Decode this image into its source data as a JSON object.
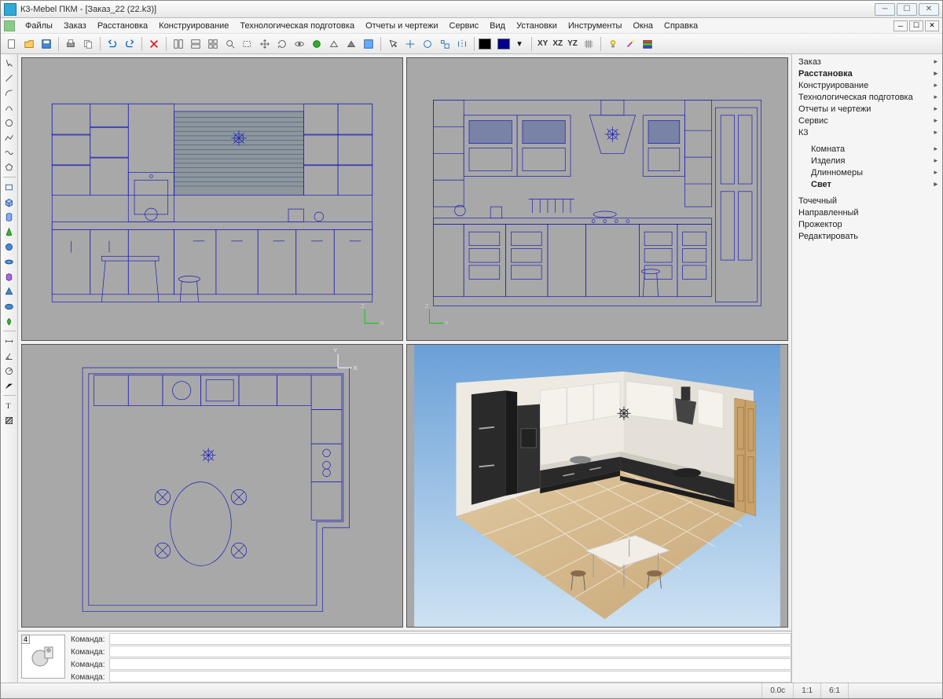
{
  "window": {
    "title": "К3-Mebel ПКМ - [Заказ_22 (22.k3)]"
  },
  "menu": [
    "Файлы",
    "Заказ",
    "Расстановка",
    "Конструирование",
    "Технологическая подготовка",
    "Отчеты и чертежи",
    "Сервис",
    "Вид",
    "Установки",
    "Инструменты",
    "Окна",
    "Справка"
  ],
  "axes_labels": {
    "xy": "XY",
    "xz": "XZ",
    "yz": "YZ"
  },
  "rightpanel": {
    "group1": [
      {
        "label": "Заказ",
        "bold": false
      },
      {
        "label": "Расстановка",
        "bold": true
      },
      {
        "label": "Конструирование",
        "bold": false
      },
      {
        "label": "Технологическая подготовка",
        "bold": false
      },
      {
        "label": "Отчеты и чертежи",
        "bold": false
      },
      {
        "label": "Сервис",
        "bold": false
      },
      {
        "label": "К3",
        "bold": false
      }
    ],
    "group2": [
      {
        "label": "Комната",
        "bold": false
      },
      {
        "label": "Изделия",
        "bold": false
      },
      {
        "label": "Длинномеры",
        "bold": false
      },
      {
        "label": "Свет",
        "bold": true
      }
    ],
    "group3": [
      {
        "label": "Точечный"
      },
      {
        "label": "Направленный"
      },
      {
        "label": "Прожектор"
      },
      {
        "label": "Редактировать"
      }
    ]
  },
  "command": {
    "label": "Команда:",
    "lines": [
      "",
      "",
      "",
      ""
    ]
  },
  "status": {
    "time": "0.0с",
    "ratio": "1:1",
    "scale": "6:1"
  },
  "colors": {
    "swatch1": "#000000",
    "swatch2": "#000088"
  }
}
